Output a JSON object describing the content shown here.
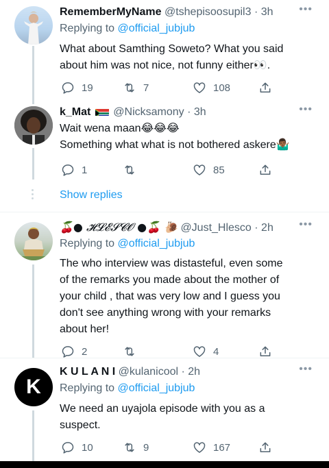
{
  "tweets": [
    {
      "name": "RememberMyName",
      "handle": "@tshepisoosupil3",
      "sep": " · ",
      "time": "3h",
      "replying_prefix": "Replying to ",
      "replying_to": "@official_jubjub",
      "lines": [
        "What about Samthing Soweto? What you said",
        "about him was not nice, not funny either👀."
      ],
      "replies": "19",
      "retweets": "7",
      "likes": "108"
    },
    {
      "name": "k_Mat",
      "handle": "@Nicksamony",
      "sep": " · ",
      "time": "3h",
      "lines": [
        "Wait wena maan😂😂😂",
        "Something what what is not bothered askere🤷🏾‍♂️"
      ],
      "replies": "1",
      "retweets": "",
      "likes": "85"
    },
    {
      "name": "🍒● 𝓗𝓛𝓔𝓢𝓒𝓞 ●🍒 🐌",
      "handle": "@Just_Hlesco",
      "sep": " · ",
      "time": "2h",
      "replying_prefix": "Replying to ",
      "replying_to": "@official_jubjub",
      "lines": [
        "The who interview was distasteful,  even some",
        "of the remarks you made about the mother of",
        "your child , that was very low and I guess you",
        "don't see anything wrong with your remarks",
        "about her!"
      ],
      "replies": "2",
      "retweets": "",
      "likes": "4"
    },
    {
      "name": "K U L A N I",
      "handle": "@kulanicool",
      "sep": " · ",
      "time": "2h",
      "replying_prefix": "Replying to ",
      "replying_to": "@official_jubjub",
      "lines": [
        "We need an uyajola episode with you as a",
        "suspect."
      ],
      "replies": "10",
      "retweets": "9",
      "likes": "167"
    }
  ],
  "show_replies": "Show replies",
  "more_glyph": "•••",
  "kulani_avatar_letter": "K",
  "colors": {
    "accent": "#1d9bf0",
    "secondary_text": "#536471",
    "primary_text": "#0f1419",
    "divider": "#eff3f4"
  },
  "icons": [
    "reply-icon",
    "retweet-icon",
    "like-icon",
    "share-icon",
    "more-icon",
    "south-africa-flag-icon"
  ]
}
